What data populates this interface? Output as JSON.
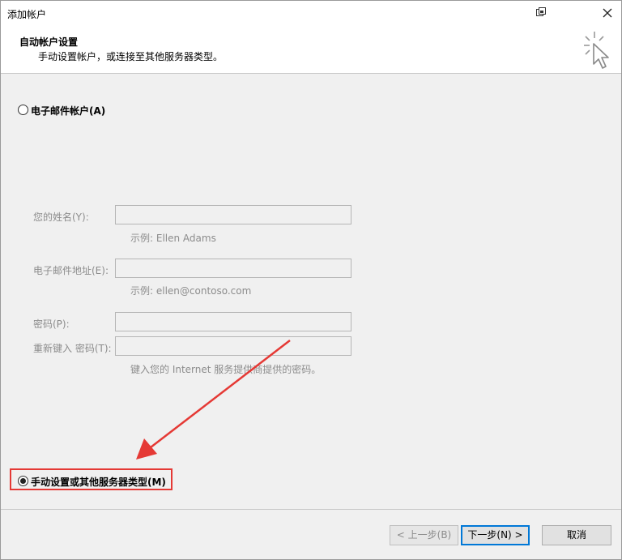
{
  "window": {
    "title": "添加帐户"
  },
  "header": {
    "title": "自动帐户设置",
    "subtitle": "手动设置帐户，或连接至其他服务器类型。"
  },
  "options": {
    "email_account": {
      "label": "电子邮件帐户(A)",
      "selected": false
    },
    "manual_setup": {
      "label": "手动设置或其他服务器类型(M)",
      "selected": true
    }
  },
  "form": {
    "name": {
      "label": "您的姓名(Y):",
      "value": "",
      "hint": "示例: Ellen Adams"
    },
    "email": {
      "label": "电子邮件地址(E):",
      "value": "",
      "hint": "示例: ellen@contoso.com"
    },
    "password": {
      "label": "密码(P):",
      "value": ""
    },
    "password_confirm": {
      "label": "重新键入 密码(T):",
      "value": "",
      "hint": "键入您的 Internet 服务提供商提供的密码。"
    }
  },
  "buttons": {
    "back": "< 上一步(B)",
    "next": "下一步(N) >",
    "cancel": "取消"
  },
  "colors": {
    "annotation": "#e53935",
    "focus": "#0078d7"
  }
}
